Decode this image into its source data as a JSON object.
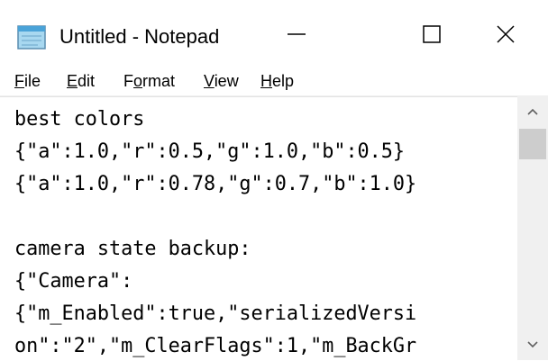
{
  "window": {
    "title": "Untitled - Notepad",
    "controls": {
      "minimize_icon": "minimize-icon",
      "maximize_icon": "maximize-icon",
      "close_icon": "close-icon"
    }
  },
  "menu": {
    "items": [
      {
        "mnemonic": "F",
        "rest": "ile"
      },
      {
        "mnemonic": "E",
        "rest": "dit"
      },
      {
        "pre": "F",
        "mnemonic": "o",
        "rest": "rmat"
      },
      {
        "mnemonic": "V",
        "rest": "iew"
      },
      {
        "mnemonic": "H",
        "rest": "elp"
      }
    ]
  },
  "editor": {
    "lines": [
      "best colors",
      "{\"a\":1.0,\"r\":0.5,\"g\":1.0,\"b\":0.5}",
      "{\"a\":1.0,\"r\":0.78,\"g\":0.7,\"b\":1.0}",
      "",
      "camera state backup:",
      "{\"Camera\":",
      "{\"m_Enabled\":true,\"serializedVersi",
      "on\":\"2\",\"m_ClearFlags\":1,\"m_BackGr"
    ]
  },
  "colors": {
    "text": "#000000",
    "window_bg": "#ffffff",
    "scrollbar_track": "#f0f0f0",
    "scrollbar_thumb": "#cdcdcd"
  }
}
